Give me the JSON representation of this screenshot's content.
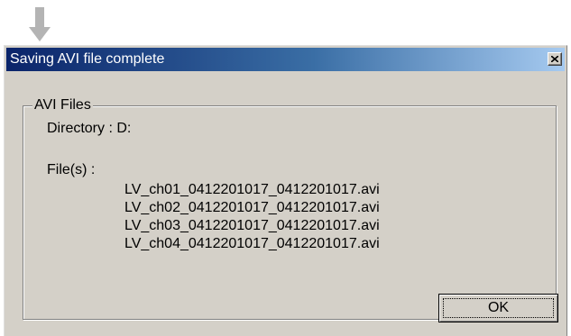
{
  "window": {
    "title": "Saving AVI file complete",
    "close_icon": "close-x-icon"
  },
  "indicator": {
    "icon": "down-arrow-icon",
    "color": "#b4b4b4"
  },
  "group": {
    "label": "AVI Files",
    "directory_label": "Directory : D:",
    "files_label": "File(s) :",
    "files": [
      "LV_ch01_0412201017_0412201017.avi",
      "LV_ch02_0412201017_0412201017.avi",
      "LV_ch03_0412201017_0412201017.avi",
      "LV_ch04_0412201017_0412201017.avi"
    ]
  },
  "buttons": {
    "ok_label": "OK"
  },
  "colors": {
    "titlebar_start": "#0a246a",
    "titlebar_end": "#a6caf0",
    "dialog_bg": "#d4d0c8"
  }
}
